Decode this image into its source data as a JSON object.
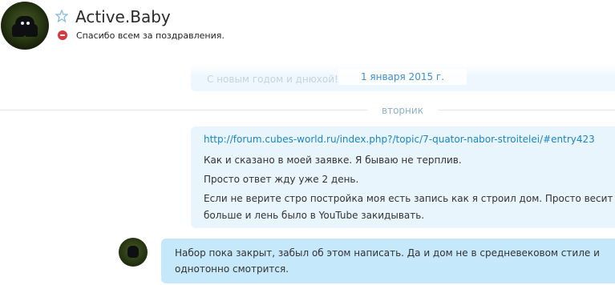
{
  "header": {
    "contact_name": "Active.Baby",
    "mood_message": "Спасибо всем за поздравления.",
    "favorite_icon": "star-outline-icon",
    "status_icon": "do-not-disturb-icon"
  },
  "previous_message": {
    "preview_text": "С новым годом и днюхой!",
    "date": "1 января 2015 г."
  },
  "day_separator": "вторник",
  "outgoing_message": {
    "link": "http://forum.cubes-world.ru/index.php?/topic/7-quator-nabor-stroitelei/#entry423",
    "lines": [
      "Как и сказано в моей заявке. Я бываю не терплив.",
      "Просто ответ жду уже 2 день.",
      "Если не верите стро постройка моя есть запись как я строил дом. Просто весит",
      "больше и лень было в YouTube закидывать."
    ]
  },
  "incoming_message": {
    "lines": [
      "Набор пока закрыт, забыл об этом написать. Да и дом не в средневековом стиле и",
      "однотонно смотрится."
    ]
  },
  "colors": {
    "link": "#1a85c7",
    "outgoing_bubble": "#e9f5fd",
    "incoming_bubble": "#c6e8fb",
    "status_dnd": "#d9363e"
  }
}
